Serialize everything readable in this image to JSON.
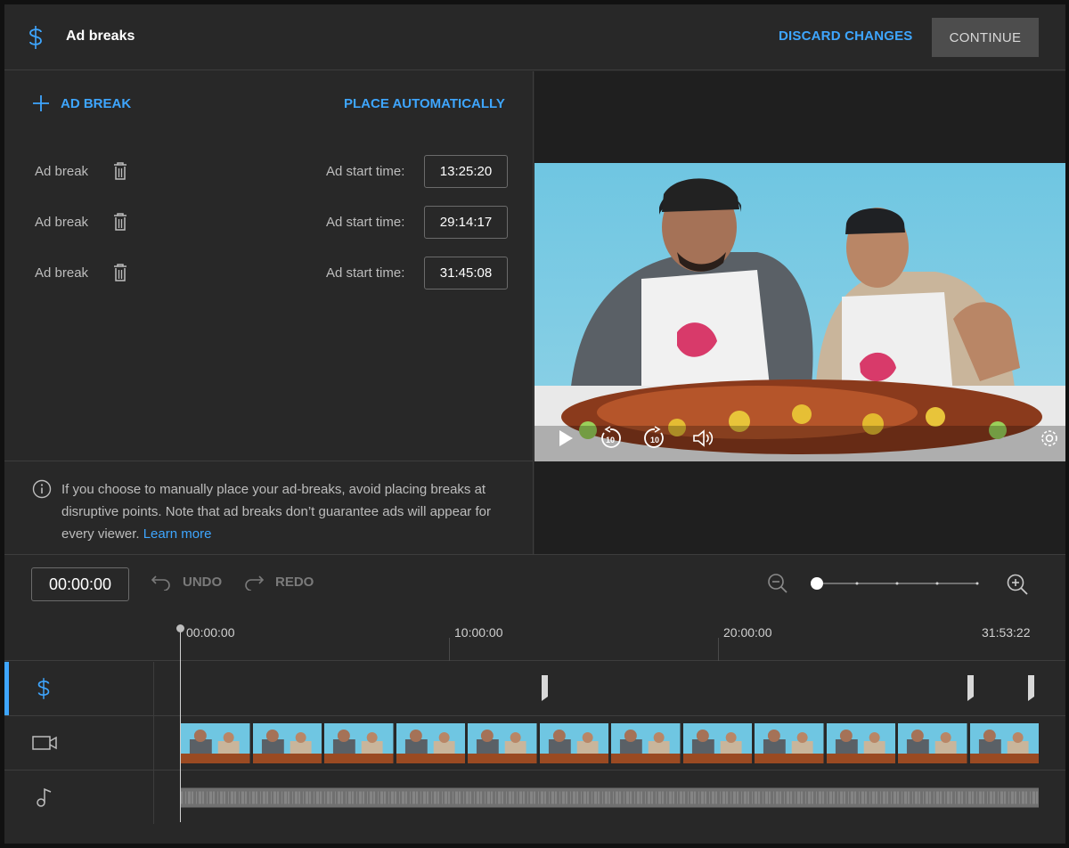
{
  "header": {
    "title": "Ad breaks",
    "icon": "dollar-icon",
    "discard_label": "DISCARD CHANGES",
    "continue_label": "CONTINUE"
  },
  "panel": {
    "add_label": "AD BREAK",
    "place_auto_label": "PLACE AUTOMATICALLY",
    "start_time_label": "Ad start time:",
    "breaks": [
      {
        "name": "Ad break",
        "start": "13:25:20"
      },
      {
        "name": "Ad break",
        "start": "29:14:17"
      },
      {
        "name": "Ad break",
        "start": "31:45:08"
      }
    ],
    "info_text": "If you choose to manually place your ad-breaks, avoid placing breaks at disruptive points. Note that ad breaks don’t guarantee ads will appear for every viewer.",
    "learn_more": "Learn more"
  },
  "player": {
    "controls": [
      "play-icon",
      "rewind-10-icon",
      "forward-10-icon",
      "volume-icon",
      "settings-gear-icon"
    ]
  },
  "timeline": {
    "timecode": "00:00:00",
    "undo_label": "UNDO",
    "redo_label": "REDO",
    "zoom_level": 0,
    "ruler": [
      "00:00:00",
      "10:00:00",
      "20:00:00",
      "31:53:22"
    ],
    "tracks": [
      "dollar-icon",
      "video-icon",
      "music-note-icon"
    ]
  },
  "colors": {
    "accent": "#3ea6ff",
    "background": "#282828",
    "panel_dark": "#1f1f1f"
  }
}
